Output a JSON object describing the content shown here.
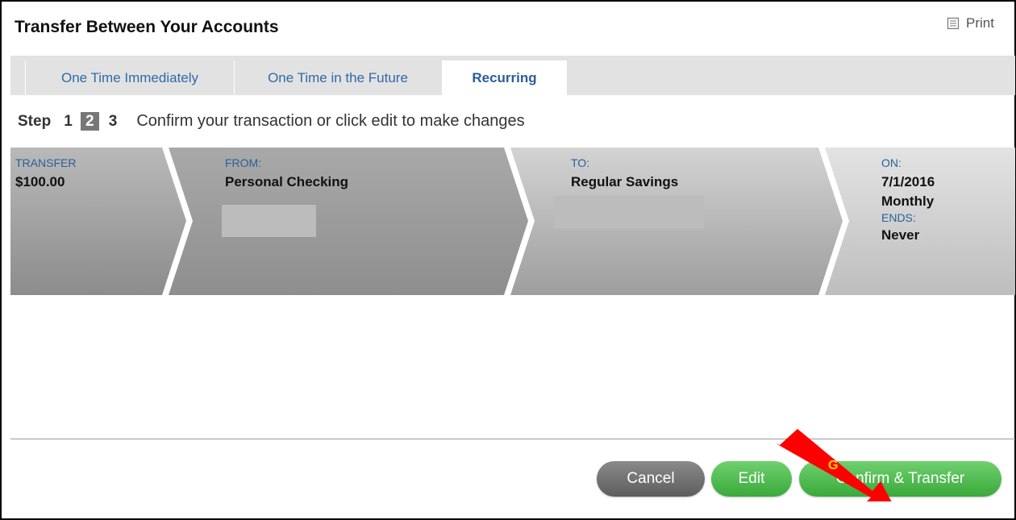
{
  "header": {
    "title": "Transfer Between Your Accounts",
    "print_label": "Print"
  },
  "tabs": [
    {
      "label": "One Time Immediately",
      "active": false
    },
    {
      "label": "One Time in the Future",
      "active": false
    },
    {
      "label": "Recurring",
      "active": true
    }
  ],
  "steps": {
    "word": "Step",
    "numbers": [
      "1",
      "2",
      "3"
    ],
    "current": "2",
    "instruction": "Confirm your transaction or click edit to make changes"
  },
  "summary": {
    "transfer_label": "TRANSFER",
    "amount": "$100.00",
    "from_label": "FROM:",
    "from_account": "Personal Checking",
    "to_label": "TO:",
    "to_account": "Regular Savings",
    "on_label": "ON:",
    "date": "7/1/2016",
    "frequency": "Monthly",
    "ends_label": "ENDS:",
    "ends_value": "Never"
  },
  "buttons": {
    "cancel": "Cancel",
    "edit": "Edit",
    "confirm": "Confirm & Transfer"
  },
  "annotation": {
    "arrow_label": "G",
    "arrow_color": "#ff0000",
    "arrow_label_color": "#ffd700"
  },
  "colors": {
    "accent_blue": "#2e6aa9",
    "button_green": "#4cbb4c",
    "button_gray": "#6e6e6e"
  }
}
